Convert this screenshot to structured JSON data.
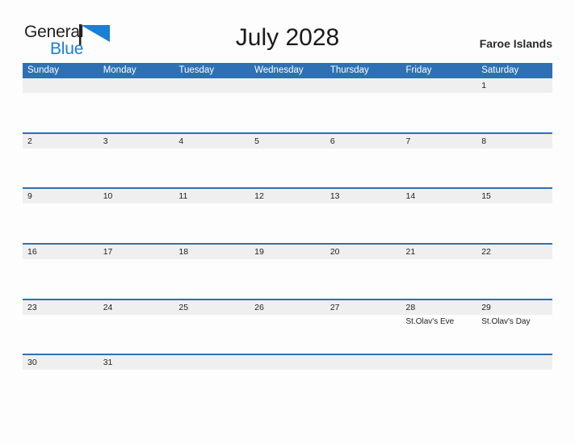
{
  "branding": {
    "logo_text_primary": "General",
    "logo_text_secondary": "Blue",
    "logo_flag_color": "#1b7fd4",
    "logo_primary_color": "#221f1f",
    "logo_secondary_color": "#1b7fd4"
  },
  "header": {
    "title": "July 2028",
    "country": "Faroe Islands"
  },
  "theme": {
    "header_blue": "#2d71b4",
    "row_divider_blue": "#2d71b4",
    "date_band_gray": "#efefef",
    "page_background": "#fdfdfd",
    "text_color": "#1f1f1f"
  },
  "calendar": {
    "month": "July",
    "year": "2028",
    "weekday_headers": [
      "Sunday",
      "Monday",
      "Tuesday",
      "Wednesday",
      "Thursday",
      "Friday",
      "Saturday"
    ],
    "weeks": [
      [
        {
          "day": "",
          "event": ""
        },
        {
          "day": "",
          "event": ""
        },
        {
          "day": "",
          "event": ""
        },
        {
          "day": "",
          "event": ""
        },
        {
          "day": "",
          "event": ""
        },
        {
          "day": "",
          "event": ""
        },
        {
          "day": "1",
          "event": ""
        }
      ],
      [
        {
          "day": "2",
          "event": ""
        },
        {
          "day": "3",
          "event": ""
        },
        {
          "day": "4",
          "event": ""
        },
        {
          "day": "5",
          "event": ""
        },
        {
          "day": "6",
          "event": ""
        },
        {
          "day": "7",
          "event": ""
        },
        {
          "day": "8",
          "event": ""
        }
      ],
      [
        {
          "day": "9",
          "event": ""
        },
        {
          "day": "10",
          "event": ""
        },
        {
          "day": "11",
          "event": ""
        },
        {
          "day": "12",
          "event": ""
        },
        {
          "day": "13",
          "event": ""
        },
        {
          "day": "14",
          "event": ""
        },
        {
          "day": "15",
          "event": ""
        }
      ],
      [
        {
          "day": "16",
          "event": ""
        },
        {
          "day": "17",
          "event": ""
        },
        {
          "day": "18",
          "event": ""
        },
        {
          "day": "19",
          "event": ""
        },
        {
          "day": "20",
          "event": ""
        },
        {
          "day": "21",
          "event": ""
        },
        {
          "day": "22",
          "event": ""
        }
      ],
      [
        {
          "day": "23",
          "event": ""
        },
        {
          "day": "24",
          "event": ""
        },
        {
          "day": "25",
          "event": ""
        },
        {
          "day": "26",
          "event": ""
        },
        {
          "day": "27",
          "event": ""
        },
        {
          "day": "28",
          "event": "St.Olav's Eve"
        },
        {
          "day": "29",
          "event": "St.Olav's Day"
        }
      ],
      [
        {
          "day": "30",
          "event": ""
        },
        {
          "day": "31",
          "event": ""
        },
        {
          "day": "",
          "event": ""
        },
        {
          "day": "",
          "event": ""
        },
        {
          "day": "",
          "event": ""
        },
        {
          "day": "",
          "event": ""
        },
        {
          "day": "",
          "event": ""
        }
      ]
    ]
  }
}
